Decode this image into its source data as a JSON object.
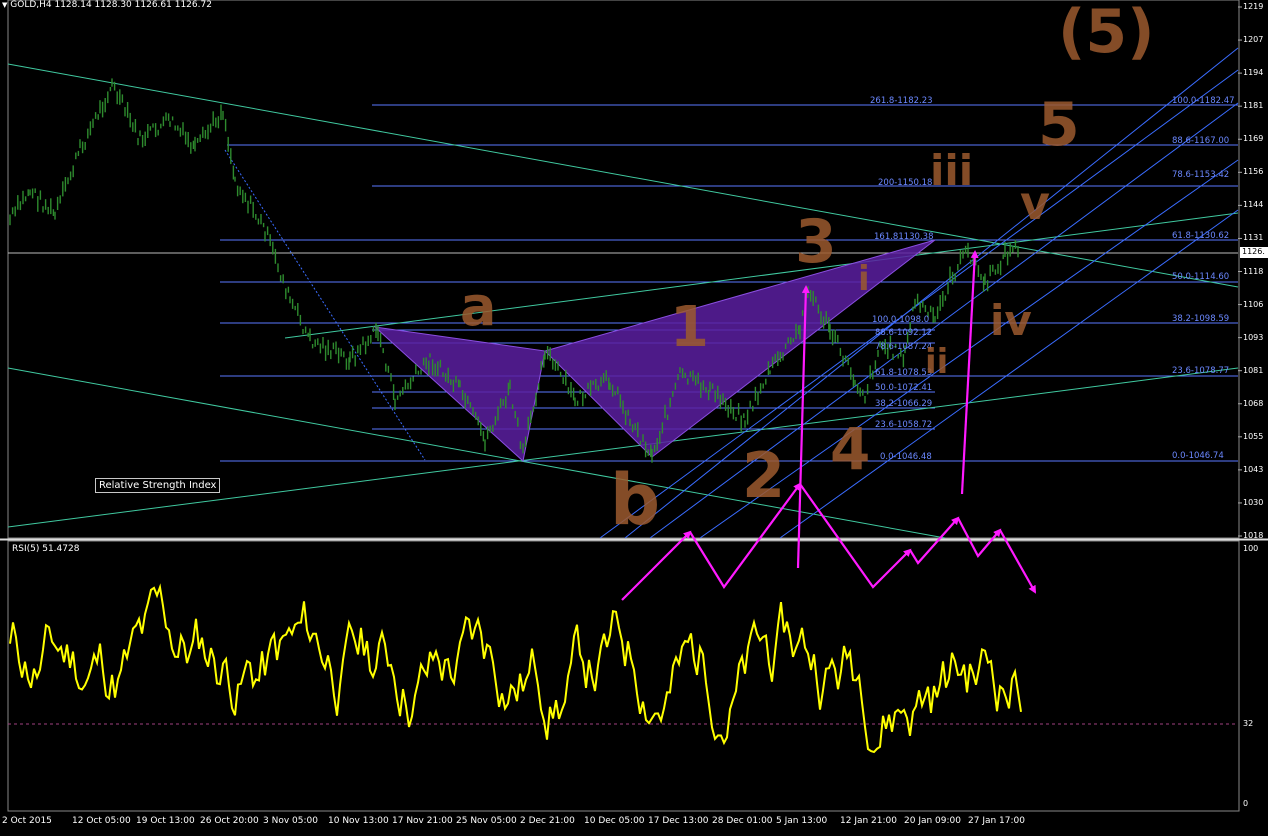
{
  "header": {
    "symbol_line": "GOLD,H4  1128.14 1128.30 1126.61 1126.72"
  },
  "price_scale": [
    "1219",
    "1207",
    "1194",
    "1181",
    "1169",
    "1156",
    "1144",
    "1131",
    "1118",
    "1106",
    "1093",
    "1081",
    "1068",
    "1055",
    "1043",
    "1030",
    "1018"
  ],
  "current_price": "1126.",
  "date_axis": [
    "2 Oct 2015",
    "12 Oct 05:00",
    "19 Oct 13:00",
    "26 Oct 20:00",
    "3 Nov 05:00",
    "10 Nov 13:00",
    "17 Nov 21:00",
    "25 Nov 05:00",
    "2 Dec 21:00",
    "10 Dec 05:00",
    "17 Dec 13:00",
    "28 Dec 01:00",
    "5 Jan 13:00",
    "12 Jan 21:00",
    "20 Jan 09:00",
    "27 Jan 17:00"
  ],
  "fib_labels_main": [
    "261.8-1182.23",
    "200-1150.18",
    "161.81130.38",
    "100.0-1098.0",
    "88.6-1092.12",
    "78.6-1087.24",
    "61.8-1078.53",
    "50.0-1072.41",
    "38.2-1066.29",
    "23.6-1058.72",
    "0.0-1046.48"
  ],
  "fib_labels_right": [
    "100.0-1182.47",
    "88.6-1167.00",
    "78.6-1153.42",
    "61.8-1130.62",
    "50.0-1114.60",
    "38.2-1098.59",
    "23.6-1078.77",
    "0.0-1046.74"
  ],
  "tooltip": "Relative Strength Index",
  "rsi": {
    "header": "RSI(5) 51.4728",
    "scale": [
      "100",
      "32",
      "0"
    ]
  },
  "annotations": {
    "wave_labels": [
      "a",
      "b",
      "1",
      "2",
      "3",
      "4",
      "5",
      "(5)",
      "iii",
      "iv",
      "v",
      "i",
      "ii"
    ]
  },
  "colors": {
    "background": "#000000",
    "candles": "#2e8b2e",
    "rsi_line": "#ffff00",
    "fib_lines": "#5a78ff",
    "trend_lines": "#40c9a0",
    "pattern_fill": "#5a1fa0",
    "arrows": "#ff1aff",
    "handwriting": "#9c5a2e"
  }
}
